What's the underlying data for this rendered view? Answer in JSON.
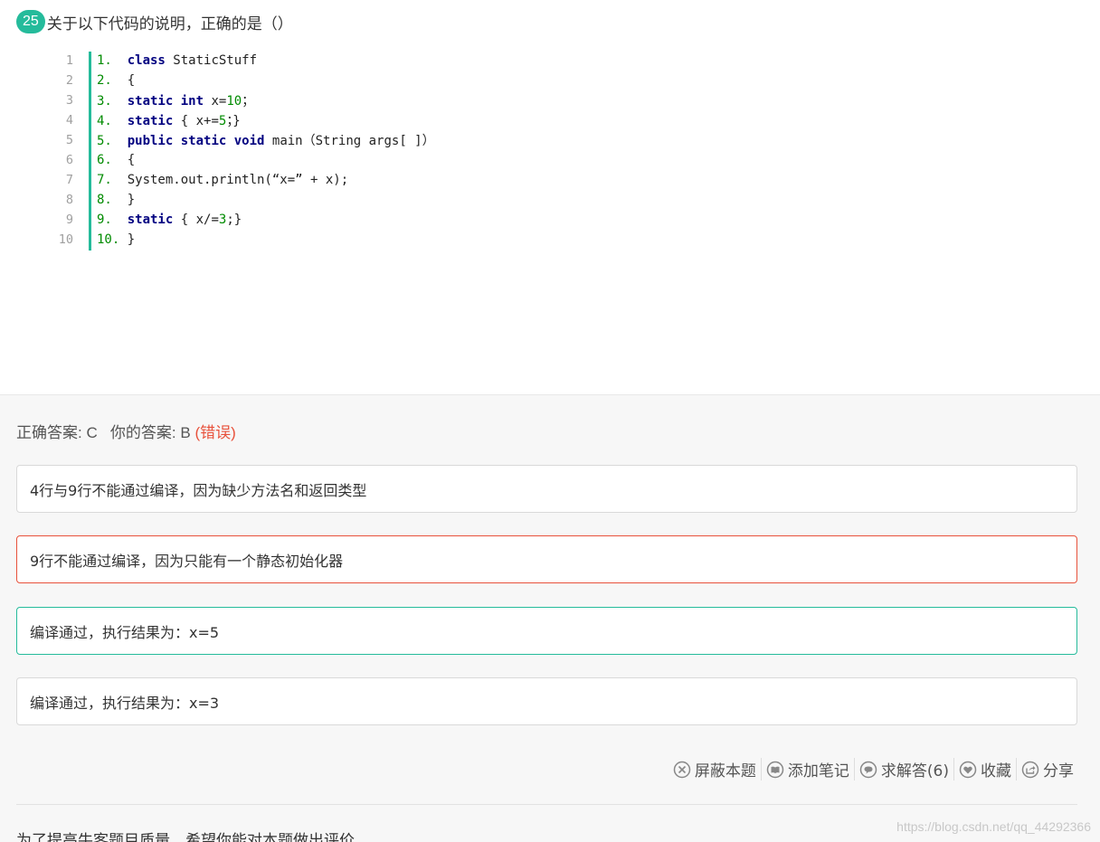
{
  "question": {
    "number": "25",
    "title": "关于以下代码的说明，正确的是（）"
  },
  "code": {
    "line_numbers": [
      "1",
      "2",
      "3",
      "4",
      "5",
      "6",
      "7",
      "8",
      "9",
      "10"
    ],
    "lines": [
      {
        "prefix": "1.  ",
        "tokens": [
          {
            "t": "class",
            "k": "kw"
          },
          {
            "t": " StaticStuff",
            "k": ""
          }
        ]
      },
      {
        "prefix": "2.  ",
        "tokens": [
          {
            "t": "{",
            "k": ""
          }
        ]
      },
      {
        "prefix": "3.  ",
        "tokens": [
          {
            "t": "static",
            "k": "kw"
          },
          {
            "t": " ",
            "k": ""
          },
          {
            "t": "int",
            "k": "kw"
          },
          {
            "t": " x=",
            "k": ""
          },
          {
            "t": "10",
            "k": "num"
          },
          {
            "t": "；",
            "k": ""
          }
        ]
      },
      {
        "prefix": "4.  ",
        "tokens": [
          {
            "t": "static",
            "k": "kw"
          },
          {
            "t": " { x+=",
            "k": ""
          },
          {
            "t": "5",
            "k": "num"
          },
          {
            "t": "；}",
            "k": ""
          }
        ]
      },
      {
        "prefix": "5.  ",
        "tokens": [
          {
            "t": "public",
            "k": "kw"
          },
          {
            "t": " ",
            "k": ""
          },
          {
            "t": "static",
            "k": "kw"
          },
          {
            "t": " ",
            "k": ""
          },
          {
            "t": "void",
            "k": "kw"
          },
          {
            "t": " main（String args[ ]）",
            "k": ""
          }
        ]
      },
      {
        "prefix": "6.  ",
        "tokens": [
          {
            "t": "{",
            "k": ""
          }
        ]
      },
      {
        "prefix": "7.  ",
        "tokens": [
          {
            "t": "System.out.println(“x=” + x);",
            "k": ""
          }
        ]
      },
      {
        "prefix": "8.  ",
        "tokens": [
          {
            "t": "}",
            "k": ""
          }
        ]
      },
      {
        "prefix": "9.  ",
        "tokens": [
          {
            "t": "static",
            "k": "kw"
          },
          {
            "t": " { x/=",
            "k": ""
          },
          {
            "t": "3",
            "k": "num"
          },
          {
            "t": ";}",
            "k": ""
          }
        ]
      },
      {
        "prefix": "10. ",
        "tokens": [
          {
            "t": "}",
            "k": ""
          }
        ]
      }
    ]
  },
  "result": {
    "correct_label": "正确答案: C",
    "your_label": "你的答案: B",
    "wrong_tag": "(错误)"
  },
  "options": [
    {
      "text": "4行与9行不能通过编译，因为缺少方法名和返回类型",
      "state": "normal"
    },
    {
      "text": "9行不能通过编译，因为只能有一个静态初始化器",
      "state": "wrong"
    },
    {
      "text": "编译通过，执行结果为：x=5",
      "state": "correct"
    },
    {
      "text": "编译通过，执行结果为：x=3",
      "state": "normal"
    }
  ],
  "actions": {
    "block": "屏蔽本题",
    "note": "添加笔记",
    "ask": "求解答(6)",
    "favorite": "收藏",
    "share": "分享"
  },
  "rate_prompt": "为了提高牛客题目质量，希望你能对本题做出评价",
  "watermark": "https://blog.csdn.net/qq_44292366",
  "colors": {
    "accent": "#25bb9b",
    "error": "#e8513b",
    "keyword": "#000080",
    "number": "#008b00"
  },
  "icons": [
    "block-icon",
    "note-icon",
    "comment-icon",
    "heart-icon",
    "share-icon"
  ]
}
